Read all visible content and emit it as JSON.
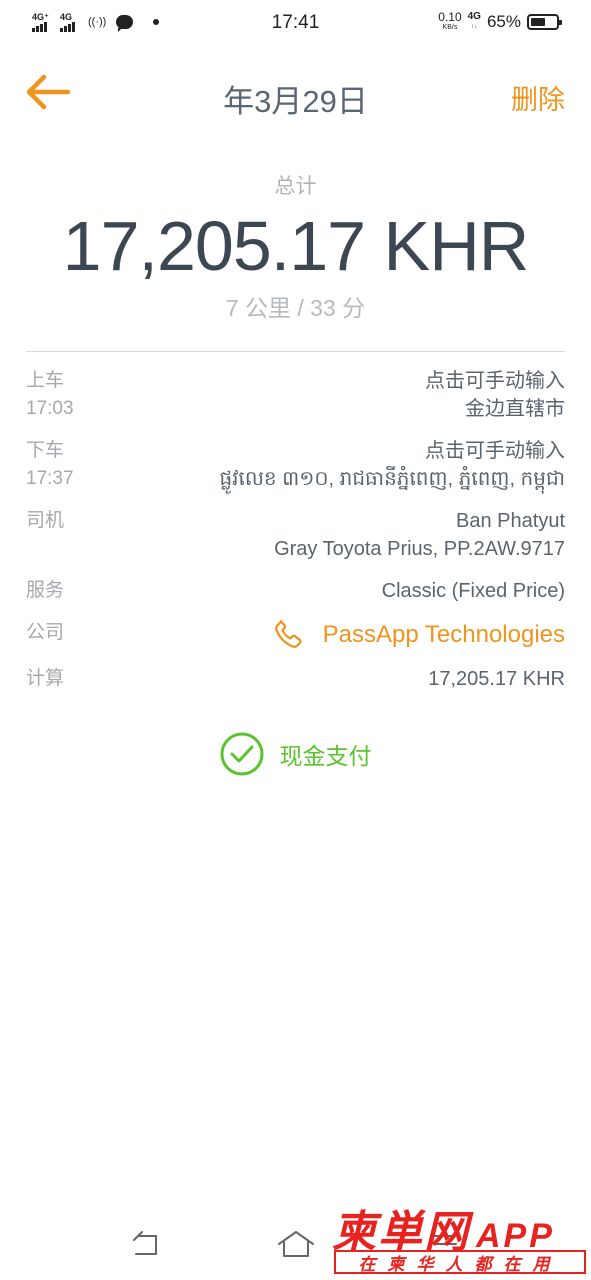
{
  "status_bar": {
    "signal1_label": "4G⁺",
    "signal2_label": "4G",
    "nfc_label": "((·))",
    "time": "17:41",
    "net_speed_value": "0.10",
    "net_speed_unit": "KB/s",
    "network_type": "4G",
    "network_sub": "↑↓",
    "battery_percent": "65%",
    "battery_level": 0.65
  },
  "header": {
    "title": "年3月29日",
    "delete_label": "删除",
    "accent_color": "#f0941e"
  },
  "summary": {
    "total_label": "总计",
    "total_amount": "17,205.17 KHR",
    "distance_time": "7 公里 / 33 分"
  },
  "details": {
    "pickup": {
      "label": "上车",
      "time": "17:03",
      "manual_input": "点击可手动输入",
      "address": "金边直辖市"
    },
    "dropoff": {
      "label": "下车",
      "time": "17:37",
      "manual_input": "点击可手动输入",
      "address": "ផ្លូវលេខ ៣១០, រាជធានីភ្នំពេញ, ភ្នំពេញ, កម្ពុជា"
    },
    "driver": {
      "label": "司机",
      "name": "Ban Phatyut",
      "vehicle": "Gray Toyota Prius, PP.2AW.9717"
    },
    "service": {
      "label": "服务",
      "value": "Classic (Fixed Price)"
    },
    "company": {
      "label": "公司",
      "value": "PassApp Technologies",
      "icon": "phone-icon"
    },
    "calculation": {
      "label": "计算",
      "value": "17,205.17 KHR"
    }
  },
  "payment": {
    "label": "现金支付",
    "icon": "check-circle-icon",
    "color": "#5cc22e"
  },
  "watermark": {
    "brand": "柬単网",
    "app": "APP",
    "slogan": "在柬华人都在用",
    "color": "#e8231f"
  }
}
